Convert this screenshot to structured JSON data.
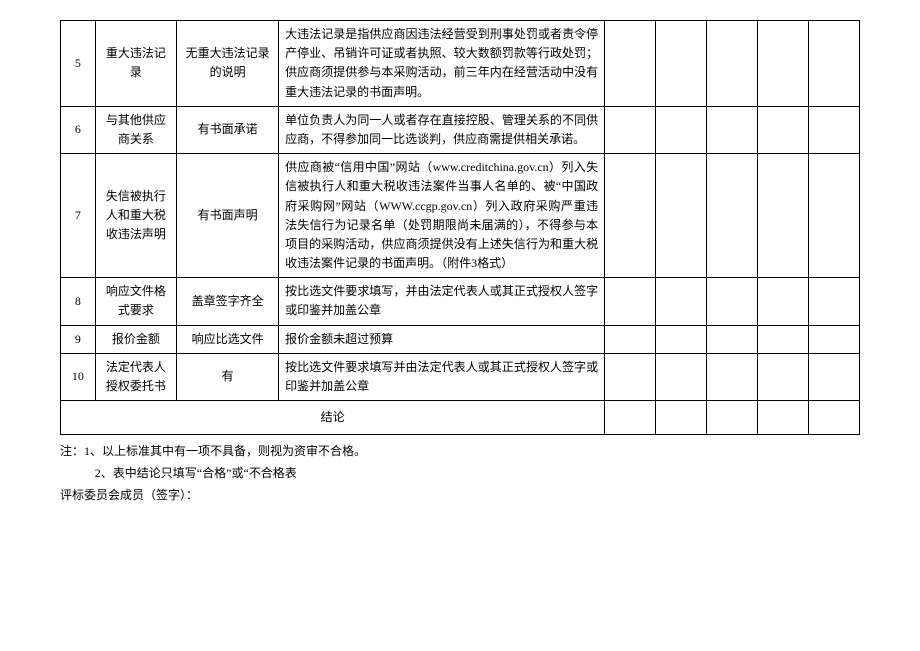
{
  "rows": [
    {
      "num": "5",
      "item": "重大违法记录",
      "standard": "无重大违法记录的说明",
      "desc": "大违法记录是指供应商因违法经营受到刑事处罚或者责令停产停业、吊销许可证或者执照、较大数额罚款等行政处罚；供应商须提供参与本采购活动，前三年内在经营活动中没有重大违法记录的书面声明。"
    },
    {
      "num": "6",
      "item": "与其他供应商关系",
      "standard": "有书面承诺",
      "desc": "单位负责人为同一人或者存在直接控股、管理关系的不同供应商，不得参加同一比选谈判，供应商需提供相关承诺。"
    },
    {
      "num": "7",
      "item": "失信被执行人和重大税收违法声明",
      "standard": "有书面声明",
      "desc": "供应商被“信用中国”网站（www.creditchina.gov.cn）列入失信被执行人和重大税收违法案件当事人名单的、被“中国政府采购网”网站（WWW.ccgp.gov.cn）列入政府采购严重违法失信行为记录名单（处罚期限尚未届满的），不得参与本项目的采购活动，供应商须提供没有上述失信行为和重大税收违法案件记录的书面声明。（附件3格式）"
    },
    {
      "num": "8",
      "item": "响应文件格式要求",
      "standard": "盖章签字齐全",
      "desc": "按比选文件要求填写，并由法定代表人或其正式授权人签字或印鉴并加盖公章"
    },
    {
      "num": "9",
      "item": "报价金额",
      "standard": "响应比选文件",
      "desc": "报价金额未超过预算"
    },
    {
      "num": "10",
      "item": "法定代表人授权委托书",
      "standard": "有",
      "desc": "按比选文件要求填写并由法定代表人或其正式授权人签字或印鉴并加盖公章"
    }
  ],
  "conclusion_label": "结论",
  "notes": {
    "line1": "注：1、以上标准其中有一项不具备，则视为资审不合格。",
    "line2": "2、表中结论只填写“合格”或“不合格表"
  },
  "signature_label": "评标委员会成员（签字）："
}
